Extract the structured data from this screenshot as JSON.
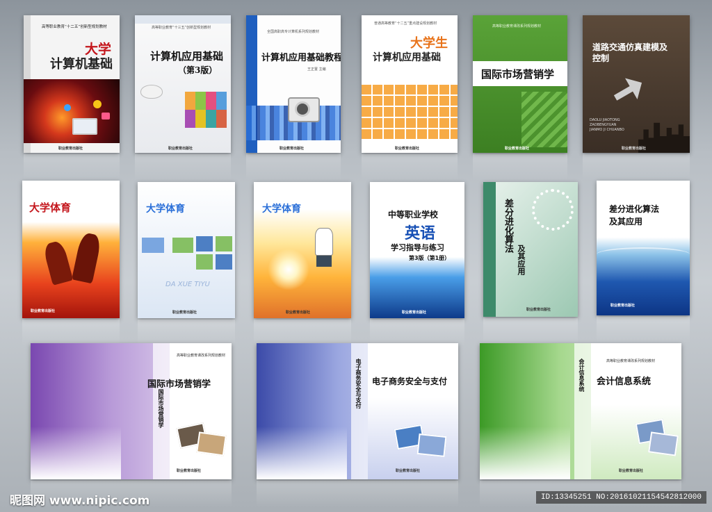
{
  "row1": [
    {
      "series": "高等职业教育“十二五”创新型规划教材",
      "title1": "大学",
      "title2": "计算机基础",
      "pub": "职业教育出版社"
    },
    {
      "series": "高等职业教育“十三五”创新型规划教材",
      "title1": "计算机应用基础",
      "title2": "（第3版）",
      "pub": "职业教育出版社"
    },
    {
      "series": "全国高职高专计算机系列规划教材",
      "title1": "计算机应用基础教程",
      "editor": "王正置 主编",
      "pub": "职业教育出版社"
    },
    {
      "series": "普通高等教育“十二五”重点建设规划教材",
      "title1": "大学生",
      "title2": "计算机应用基础",
      "pub": "职业教育出版社"
    },
    {
      "series": "高等职业教育课改系列规划教材",
      "title1": "国际市场营销学",
      "pub": "职业教育出版社"
    },
    {
      "title1": "道路交通仿真建模及控制",
      "pinyin1": "DAOLU JIAOTONG",
      "pinyin2": "ZAOBENGYUAN",
      "pinyin3": "JIANMO JI CHUANBO",
      "pub": "职业教育出版社"
    }
  ],
  "row2": [
    {
      "title1": "大学体育",
      "pub": "职业教育出版社"
    },
    {
      "title1": "大学体育",
      "pinyin": "DA XUE TIYU",
      "pub": "职业教育出版社"
    },
    {
      "title1": "大学体育",
      "pub": "职业教育出版社"
    },
    {
      "title1": "中等职业学校",
      "title2": "英语",
      "title3": "学习指导与练习",
      "title4": "第3版（第1册）",
      "pub": "职业教育出版社"
    },
    {
      "title1": "差分进化算法",
      "title2": "及其应用",
      "pub": "职业教育出版社"
    },
    {
      "title1": "差分进化算法",
      "title2": "及其应用",
      "pub": "职业教育出版社"
    }
  ],
  "row3": [
    {
      "series": "高等职业教育课改系列规划教材",
      "title": "国际市场营销学",
      "spine": "国际市场营销学",
      "pub": "职业教育出版社"
    },
    {
      "title": "电子商务安全与支付",
      "spine": "电子商务安全与支付",
      "pub": "职业教育出版社"
    },
    {
      "series": "高等职业教育课改系列规划教材",
      "title": "会计信息系统",
      "spine": "会计信息系统",
      "pub": "职业教育出版社"
    }
  ],
  "footer": {
    "logo": "昵图网 www.nipic.com",
    "id": "ID:13345251 NO:20161021154542812000"
  }
}
